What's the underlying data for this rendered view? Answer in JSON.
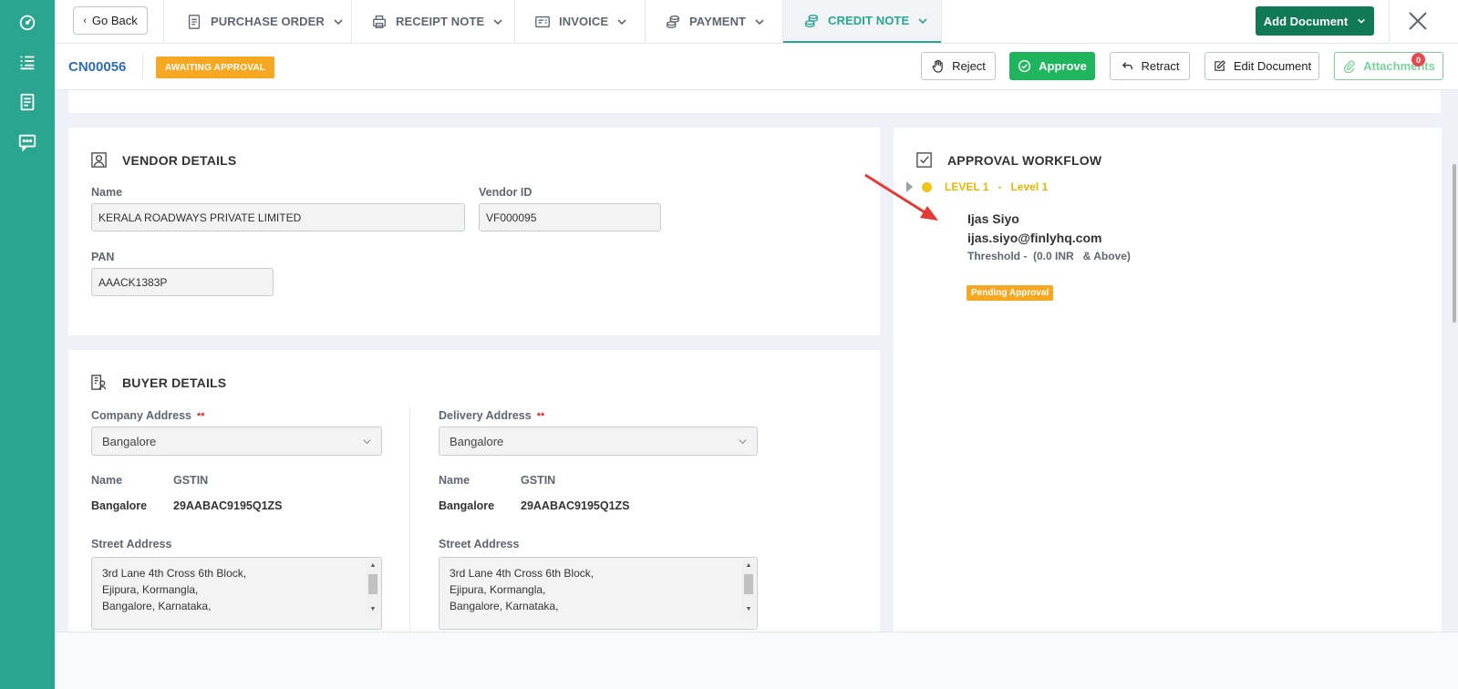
{
  "nav": {
    "go_back": "Go Back",
    "tabs": [
      {
        "label": "PURCHASE ORDER",
        "icon": "document-icon"
      },
      {
        "label": "RECEIPT NOTE",
        "icon": "printer-icon"
      },
      {
        "label": "INVOICE",
        "icon": "invoice-icon"
      },
      {
        "label": "PAYMENT",
        "icon": "coins-icon"
      },
      {
        "label": "CREDIT NOTE",
        "icon": "coins-icon",
        "active": true
      }
    ],
    "add_document": "Add Document"
  },
  "subheader": {
    "doc_number": "CN00056",
    "status": "AWAITING APPROVAL",
    "actions": {
      "reject": "Reject",
      "approve": "Approve",
      "retract": "Retract",
      "edit": "Edit Document",
      "attachments": "Attachments"
    },
    "attachments_count": "0"
  },
  "vendor": {
    "title": "VENDOR DETAILS",
    "name_label": "Name",
    "name_value": "KERALA ROADWAYS PRIVATE LIMITED",
    "vendor_id_label": "Vendor ID",
    "vendor_id_value": "VF000095",
    "pan_label": "PAN",
    "pan_value": "AAACK1383P"
  },
  "buyer": {
    "title": "BUYER DETAILS",
    "company": {
      "label": "Company Address",
      "required": "**",
      "selected": "Bangalore",
      "name_label": "Name",
      "gstin_label": "GSTIN",
      "name_value": "Bangalore",
      "gstin_value": "29AABAC9195Q1ZS",
      "street_label": "Street Address",
      "street_lines": [
        "3rd Lane 4th Cross 6th Block,",
        "Ejipura, Kormangla,",
        "Bangalore, Karnataka,"
      ]
    },
    "delivery": {
      "label": "Delivery Address",
      "required": "**",
      "selected": "Bangalore",
      "name_label": "Name",
      "gstin_label": "GSTIN",
      "name_value": "Bangalore",
      "gstin_value": "29AABAC9195Q1ZS",
      "street_label": "Street Address",
      "street_lines": [
        "3rd Lane 4th Cross 6th Block,",
        "Ejipura, Kormangla,",
        "Bangalore, Karnataka,"
      ]
    }
  },
  "approval": {
    "title": "APPROVAL WORKFLOW",
    "level_code": "LEVEL 1",
    "level_sep": "-",
    "level_name": "Level 1",
    "approver_name": "Ijas Siyo",
    "approver_email": "ijas.siyo@finlyhq.com",
    "threshold": "Threshold -  (0.0 INR   & Above)",
    "status": "Pending Approval"
  },
  "colors": {
    "rail": "#2aa58f",
    "brand_dark": "#0f7a55",
    "approve": "#1fb55c",
    "status_orange": "#f7a823",
    "link_blue": "#2f6db5",
    "level_yellow": "#e6b800",
    "arrow_red": "#e53935"
  }
}
